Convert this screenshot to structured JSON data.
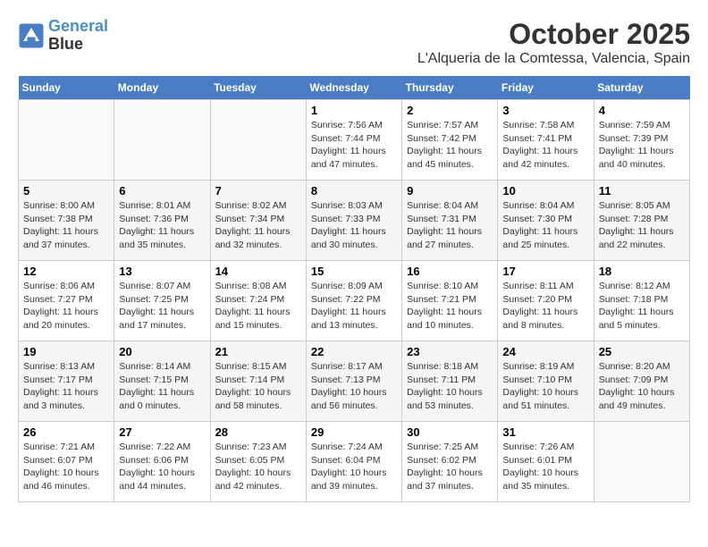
{
  "header": {
    "logo_line1": "General",
    "logo_line2": "Blue",
    "month": "October 2025",
    "location": "L'Alqueria de la Comtessa, Valencia, Spain"
  },
  "weekdays": [
    "Sunday",
    "Monday",
    "Tuesday",
    "Wednesday",
    "Thursday",
    "Friday",
    "Saturday"
  ],
  "weeks": [
    [
      {
        "day": "",
        "info": ""
      },
      {
        "day": "",
        "info": ""
      },
      {
        "day": "",
        "info": ""
      },
      {
        "day": "1",
        "info": "Sunrise: 7:56 AM\nSunset: 7:44 PM\nDaylight: 11 hours and 47 minutes."
      },
      {
        "day": "2",
        "info": "Sunrise: 7:57 AM\nSunset: 7:42 PM\nDaylight: 11 hours and 45 minutes."
      },
      {
        "day": "3",
        "info": "Sunrise: 7:58 AM\nSunset: 7:41 PM\nDaylight: 11 hours and 42 minutes."
      },
      {
        "day": "4",
        "info": "Sunrise: 7:59 AM\nSunset: 7:39 PM\nDaylight: 11 hours and 40 minutes."
      }
    ],
    [
      {
        "day": "5",
        "info": "Sunrise: 8:00 AM\nSunset: 7:38 PM\nDaylight: 11 hours and 37 minutes."
      },
      {
        "day": "6",
        "info": "Sunrise: 8:01 AM\nSunset: 7:36 PM\nDaylight: 11 hours and 35 minutes."
      },
      {
        "day": "7",
        "info": "Sunrise: 8:02 AM\nSunset: 7:34 PM\nDaylight: 11 hours and 32 minutes."
      },
      {
        "day": "8",
        "info": "Sunrise: 8:03 AM\nSunset: 7:33 PM\nDaylight: 11 hours and 30 minutes."
      },
      {
        "day": "9",
        "info": "Sunrise: 8:04 AM\nSunset: 7:31 PM\nDaylight: 11 hours and 27 minutes."
      },
      {
        "day": "10",
        "info": "Sunrise: 8:04 AM\nSunset: 7:30 PM\nDaylight: 11 hours and 25 minutes."
      },
      {
        "day": "11",
        "info": "Sunrise: 8:05 AM\nSunset: 7:28 PM\nDaylight: 11 hours and 22 minutes."
      }
    ],
    [
      {
        "day": "12",
        "info": "Sunrise: 8:06 AM\nSunset: 7:27 PM\nDaylight: 11 hours and 20 minutes."
      },
      {
        "day": "13",
        "info": "Sunrise: 8:07 AM\nSunset: 7:25 PM\nDaylight: 11 hours and 17 minutes."
      },
      {
        "day": "14",
        "info": "Sunrise: 8:08 AM\nSunset: 7:24 PM\nDaylight: 11 hours and 15 minutes."
      },
      {
        "day": "15",
        "info": "Sunrise: 8:09 AM\nSunset: 7:22 PM\nDaylight: 11 hours and 13 minutes."
      },
      {
        "day": "16",
        "info": "Sunrise: 8:10 AM\nSunset: 7:21 PM\nDaylight: 11 hours and 10 minutes."
      },
      {
        "day": "17",
        "info": "Sunrise: 8:11 AM\nSunset: 7:20 PM\nDaylight: 11 hours and 8 minutes."
      },
      {
        "day": "18",
        "info": "Sunrise: 8:12 AM\nSunset: 7:18 PM\nDaylight: 11 hours and 5 minutes."
      }
    ],
    [
      {
        "day": "19",
        "info": "Sunrise: 8:13 AM\nSunset: 7:17 PM\nDaylight: 11 hours and 3 minutes."
      },
      {
        "day": "20",
        "info": "Sunrise: 8:14 AM\nSunset: 7:15 PM\nDaylight: 11 hours and 0 minutes."
      },
      {
        "day": "21",
        "info": "Sunrise: 8:15 AM\nSunset: 7:14 PM\nDaylight: 10 hours and 58 minutes."
      },
      {
        "day": "22",
        "info": "Sunrise: 8:17 AM\nSunset: 7:13 PM\nDaylight: 10 hours and 56 minutes."
      },
      {
        "day": "23",
        "info": "Sunrise: 8:18 AM\nSunset: 7:11 PM\nDaylight: 10 hours and 53 minutes."
      },
      {
        "day": "24",
        "info": "Sunrise: 8:19 AM\nSunset: 7:10 PM\nDaylight: 10 hours and 51 minutes."
      },
      {
        "day": "25",
        "info": "Sunrise: 8:20 AM\nSunset: 7:09 PM\nDaylight: 10 hours and 49 minutes."
      }
    ],
    [
      {
        "day": "26",
        "info": "Sunrise: 7:21 AM\nSunset: 6:07 PM\nDaylight: 10 hours and 46 minutes."
      },
      {
        "day": "27",
        "info": "Sunrise: 7:22 AM\nSunset: 6:06 PM\nDaylight: 10 hours and 44 minutes."
      },
      {
        "day": "28",
        "info": "Sunrise: 7:23 AM\nSunset: 6:05 PM\nDaylight: 10 hours and 42 minutes."
      },
      {
        "day": "29",
        "info": "Sunrise: 7:24 AM\nSunset: 6:04 PM\nDaylight: 10 hours and 39 minutes."
      },
      {
        "day": "30",
        "info": "Sunrise: 7:25 AM\nSunset: 6:02 PM\nDaylight: 10 hours and 37 minutes."
      },
      {
        "day": "31",
        "info": "Sunrise: 7:26 AM\nSunset: 6:01 PM\nDaylight: 10 hours and 35 minutes."
      },
      {
        "day": "",
        "info": ""
      }
    ]
  ]
}
